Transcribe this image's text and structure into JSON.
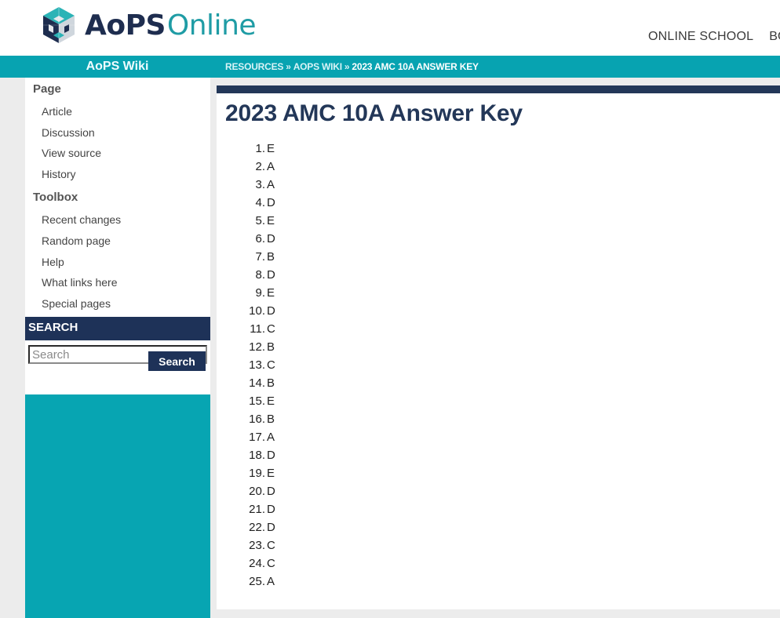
{
  "header": {
    "logo_bold": "AoPS",
    "logo_light": "Online",
    "nav": [
      "ONLINE SCHOOL",
      "BOOKSTORE"
    ]
  },
  "bar": {
    "wiki_title": "AoPS Wiki",
    "breadcrumb": [
      "RESOURCES",
      "AOPS WIKI",
      "2023 AMC 10A ANSWER KEY"
    ],
    "separator": "»"
  },
  "sidebar": {
    "page_heading": "Page",
    "page_items": [
      "Article",
      "Discussion",
      "View source",
      "History"
    ],
    "toolbox_heading": "Toolbox",
    "toolbox_items": [
      "Recent changes",
      "Random page",
      "Help",
      "What links here",
      "Special pages"
    ],
    "search_heading": "SEARCH",
    "search_placeholder": "Search",
    "search_value": "",
    "search_button": "Search"
  },
  "content": {
    "title": "2023 AMC 10A Answer Key",
    "answers": [
      "E",
      "A",
      "A",
      "D",
      "E",
      "D",
      "B",
      "D",
      "E",
      "D",
      "C",
      "B",
      "C",
      "B",
      "E",
      "B",
      "A",
      "D",
      "E",
      "D",
      "D",
      "D",
      "C",
      "C",
      "A"
    ]
  },
  "colors": {
    "navy": "#1e3258",
    "teal": "#07a3b1"
  }
}
